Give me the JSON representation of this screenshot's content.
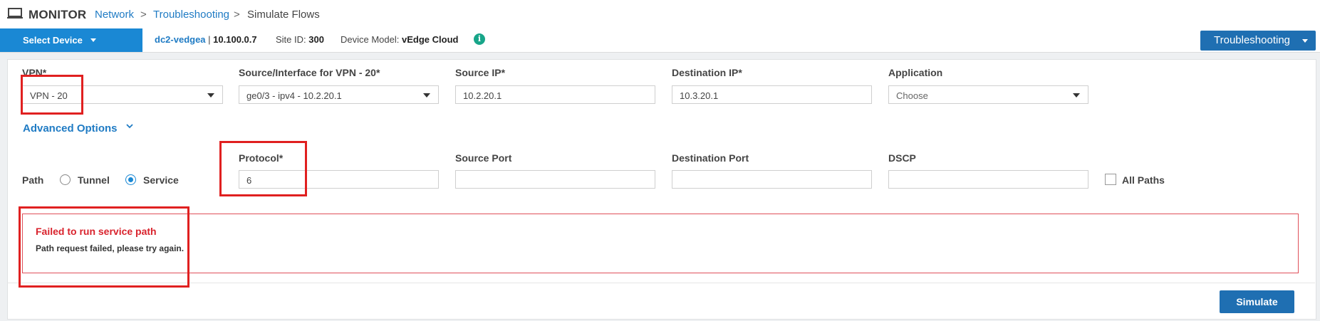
{
  "breadcrumb": {
    "section": "MONITOR",
    "items": [
      {
        "label": "Network",
        "link": true
      },
      {
        "label": "Troubleshooting",
        "link": true
      },
      {
        "label": "Simulate Flows",
        "link": false
      }
    ],
    "separator": ">"
  },
  "device_bar": {
    "select_device_label": "Select Device",
    "hostname": "dc2-vedgea",
    "ip": "10.100.0.7",
    "site_id_label": "Site ID:",
    "site_id": "300",
    "model_label": "Device Model:",
    "model": "vEdge Cloud",
    "info_glyph": "i",
    "troubleshooting_label": "Troubleshooting"
  },
  "form": {
    "vpn": {
      "label": "VPN*",
      "value": "VPN - 20"
    },
    "source_interface": {
      "label": "Source/Interface for VPN - 20*",
      "value": "ge0/3 - ipv4 - 10.2.20.1"
    },
    "source_ip": {
      "label": "Source IP*",
      "value": "10.2.20.1"
    },
    "destination_ip": {
      "label": "Destination IP*",
      "value": "10.3.20.1"
    },
    "application": {
      "label": "Application",
      "value": "Choose"
    },
    "advanced_options_label": "Advanced Options",
    "path": {
      "label": "Path",
      "options": [
        {
          "label": "Tunnel",
          "selected": false
        },
        {
          "label": "Service",
          "selected": true
        }
      ]
    },
    "protocol": {
      "label": "Protocol*",
      "value": "6"
    },
    "source_port": {
      "label": "Source Port",
      "value": ""
    },
    "destination_port": {
      "label": "Destination Port",
      "value": ""
    },
    "dscp": {
      "label": "DSCP",
      "value": ""
    },
    "all_paths": {
      "label": "All Paths",
      "checked": false
    }
  },
  "error": {
    "title": "Failed to run service path",
    "message": "Path request failed, please try again."
  },
  "simulate_label": "Simulate",
  "colors": {
    "primary": "#1a88d4",
    "button_dark": "#1f6fb2",
    "error": "#d9232d",
    "highlight": "#e02020",
    "info": "#17a589"
  },
  "icons": [
    "monitor-icon",
    "chevron-down-icon",
    "info-icon",
    "dropdown-caret-icon"
  ]
}
